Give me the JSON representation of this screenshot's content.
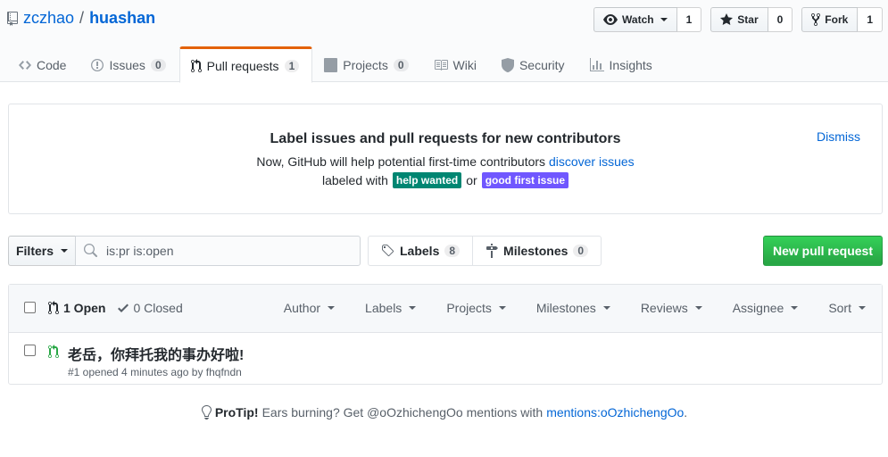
{
  "repo": {
    "owner": "zczhao",
    "separator": "/",
    "name": "huashan"
  },
  "actions": {
    "watch_label": "Watch",
    "watch_count": "1",
    "star_label": "Star",
    "star_count": "0",
    "fork_label": "Fork",
    "fork_count": "1"
  },
  "nav": {
    "code": "Code",
    "issues": "Issues",
    "issues_count": "0",
    "pulls": "Pull requests",
    "pulls_count": "1",
    "projects": "Projects",
    "projects_count": "0",
    "wiki": "Wiki",
    "security": "Security",
    "insights": "Insights"
  },
  "banner": {
    "title": "Label issues and pull requests for new contributors",
    "line1_prefix": "Now, GitHub will help potential first-time contributors",
    "line1_link": "discover issues",
    "line2_prefix": "labeled with",
    "label1": "help wanted",
    "label1_color": "#008672",
    "or_text": "or",
    "label2": "good first issue",
    "label2_color": "#7057ff",
    "dismiss": "Dismiss"
  },
  "subnav": {
    "filters_label": "Filters",
    "search_value": "is:pr is:open",
    "labels_label": "Labels",
    "labels_count": "8",
    "milestones_label": "Milestones",
    "milestones_count": "0",
    "new_pr_label": "New pull request"
  },
  "listing": {
    "open_label": "1 Open",
    "closed_label": "0 Closed",
    "filters": [
      "Author",
      "Labels",
      "Projects",
      "Milestones",
      "Reviews",
      "Assignee",
      "Sort"
    ],
    "items": [
      {
        "title": "老岳，你拜托我的事办好啦!",
        "meta": "#1 opened 4 minutes ago by fhqfndn"
      }
    ]
  },
  "protip": {
    "label": "ProTip!",
    "text": "Ears burning? Get @oOzhichengOo mentions with",
    "link": "mentions:oOzhichengOo",
    "suffix": "."
  },
  "colors": {
    "link": "#0366d6",
    "primary_button": "#28a745",
    "nav_selected_border": "#e36209",
    "open_icon": "#28a745"
  }
}
